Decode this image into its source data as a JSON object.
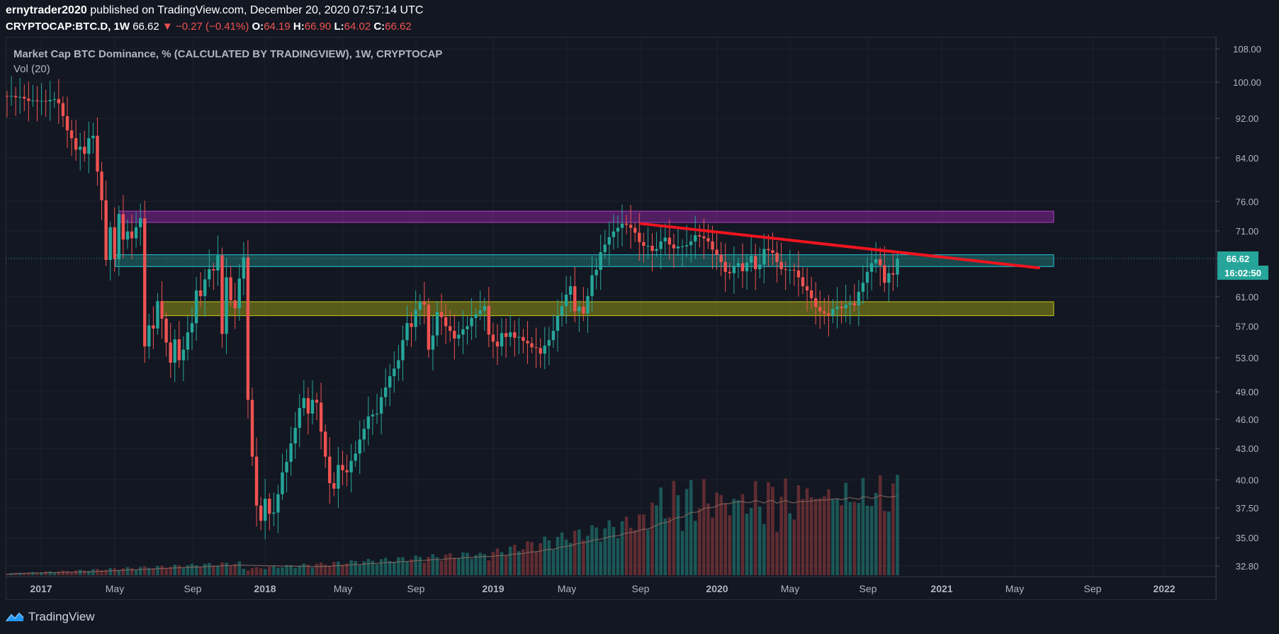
{
  "header": {
    "author": "ernytrader2020",
    "published_text": "published on TradingView.com, December 20, 2020 07:57:14 UTC",
    "symbol": "CRYPTOCAP:BTC.D, 1W",
    "last": "66.62",
    "arrow": "▼",
    "change": "−0.27 (−0.41%)",
    "o_label": "O:",
    "o_value": "64.19",
    "h_label": "H:",
    "h_value": "66.90",
    "l_label": "L:",
    "l_value": "64.02",
    "c_label": "C:",
    "c_value": "66.62"
  },
  "legend": {
    "title": "Market Cap BTC Dominance, % (CALCULATED BY TRADINGVIEW), 1W, CRYPTOCAP",
    "volume": "Vol (20)"
  },
  "price_badge": "66.62",
  "timer_badge": "16:02:50",
  "footer": {
    "brand": "TradingView"
  },
  "colors": {
    "background": "#131722",
    "up": "#26a69a",
    "down": "#ef5350",
    "trendline": "#f0141e",
    "zone_magenta": "#9c27b0",
    "zone_cyan": "#26c6da",
    "zone_yellow": "#c6c61a"
  },
  "chart_data": {
    "type": "candlestick",
    "y_scale": "log",
    "ylim": [
      32.8,
      108.0
    ],
    "y_ticks": [
      "108.00",
      "100.00",
      "92.00",
      "84.00",
      "76.00",
      "71.00",
      "66.62",
      "61.00",
      "57.00",
      "53.00",
      "49.00",
      "46.00",
      "43.00",
      "40.00",
      "37.50",
      "35.00",
      "32.80"
    ],
    "x_ticks": [
      "2017",
      "May",
      "Sep",
      "2018",
      "May",
      "Sep",
      "2019",
      "May",
      "Sep",
      "2020",
      "May",
      "Sep",
      "2021",
      "May",
      "Sep",
      "2022"
    ],
    "grid": true,
    "closes": [
      96.8,
      96.9,
      96.6,
      96.7,
      96.3,
      95.8,
      95.9,
      95.7,
      95.8,
      95.7,
      96.0,
      96.2,
      95.3,
      92.5,
      89.5,
      87.9,
      85.6,
      86.2,
      84.8,
      87.9,
      88.4,
      81.4,
      76.2,
      66.4,
      71.6,
      66.5,
      73.8,
      69.6,
      70.9,
      69.8,
      71.6,
      73.1,
      54.4,
      57.1,
      56.7,
      60.4,
      58.0,
      54.9,
      52.4,
      55.3,
      52.7,
      54.0,
      56.2,
      57.4,
      61.9,
      61.1,
      63.5,
      65.0,
      64.8,
      67.1,
      56.0,
      63.8,
      60.5,
      59.4,
      63.6,
      66.8,
      48.1,
      42.2,
      37.7,
      36.4,
      38.3,
      37.0,
      37.1,
      38.7,
      40.7,
      41.7,
      43.5,
      45.1,
      47.2,
      48.3,
      46.6,
      48.1,
      47.8,
      44.7,
      42.2,
      39.7,
      39.2,
      41.4,
      40.9,
      40.7,
      41.8,
      42.5,
      43.9,
      45.0,
      46.3,
      46.5,
      46.6,
      48.4,
      49.5,
      50.8,
      51.7,
      52.7,
      55.2,
      57.4,
      56.9,
      59.2,
      60.3,
      59.9,
      54.0,
      55.8,
      58.9,
      58.2,
      57.0,
      56.4,
      55.4,
      55.9,
      56.6,
      57.0,
      58.1,
      58.6,
      59.1,
      59.7,
      55.9,
      55.0,
      54.4,
      56.1,
      55.6,
      56.2,
      55.5,
      55.6,
      55.1,
      54.8,
      54.3,
      54.2,
      53.5,
      54.5,
      55.2,
      56.4,
      58.4,
      59.7,
      61.3,
      62.5,
      59.0,
      59.6,
      58.7,
      61.1,
      64.1,
      64.9,
      67.6,
      68.8,
      70.0,
      70.9,
      71.5,
      72.2,
      72.0,
      71.5,
      70.7,
      69.2,
      68.6,
      68.6,
      67.8,
      68.1,
      69.3,
      69.9,
      68.8,
      68.2,
      68.5,
      68.5,
      68.7,
      69.3,
      70.3,
      70.1,
      69.8,
      69.3,
      68.0,
      67.2,
      66.1,
      64.6,
      64.4,
      65.5,
      65.9,
      64.7,
      66.0,
      67.0,
      65.0,
      65.7,
      68.1,
      67.9,
      67.5,
      66.1,
      65.0,
      64.9,
      64.9,
      64.8,
      63.8,
      62.5,
      61.9,
      60.8,
      59.6,
      59.0,
      58.7,
      58.4,
      59.3,
      59.6,
      59.4,
      59.9,
      60.1,
      59.8,
      61.7,
      63.0,
      64.6,
      65.9,
      66.5,
      65.6,
      63.0,
      64.4,
      64.2,
      66.6
    ],
    "volume_ma_period": 20
  },
  "zones": [
    {
      "name": "magenta",
      "low": 72.4,
      "high": 74.3
    },
    {
      "name": "cyan",
      "low": 65.4,
      "high": 67.2
    },
    {
      "name": "yellow",
      "low": 58.4,
      "high": 60.3
    }
  ]
}
